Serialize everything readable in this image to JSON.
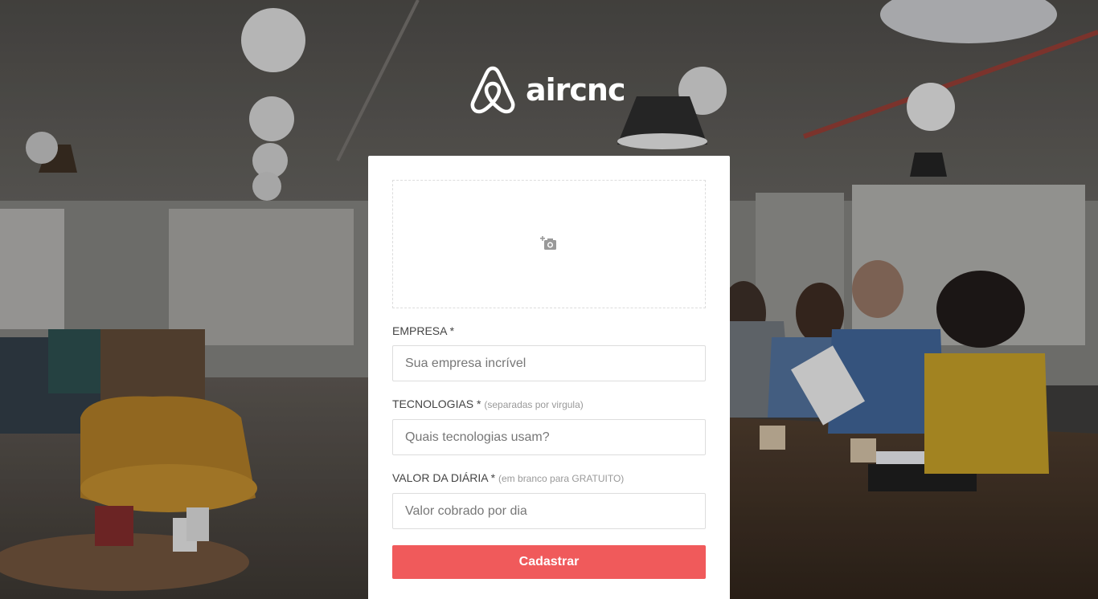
{
  "brand": {
    "name": "aircnc",
    "logo_icon": "airbnb-belo-icon",
    "accent_color": "#f05a5b"
  },
  "form": {
    "thumbnail": {
      "icon": "add-photo-icon"
    },
    "company": {
      "label": "EMPRESA",
      "required_mark": "*",
      "placeholder": "Sua empresa incrível",
      "value": ""
    },
    "techs": {
      "label": "TECNOLOGIAS",
      "required_mark": "*",
      "hint": "(separadas por virgula)",
      "placeholder": "Quais tecnologias usam?",
      "value": ""
    },
    "price": {
      "label": "VALOR DA DIÁRIA",
      "required_mark": "*",
      "hint": "(em branco para GRATUITO)",
      "placeholder": "Valor cobrado por dia",
      "value": ""
    },
    "submit_label": "Cadastrar"
  }
}
